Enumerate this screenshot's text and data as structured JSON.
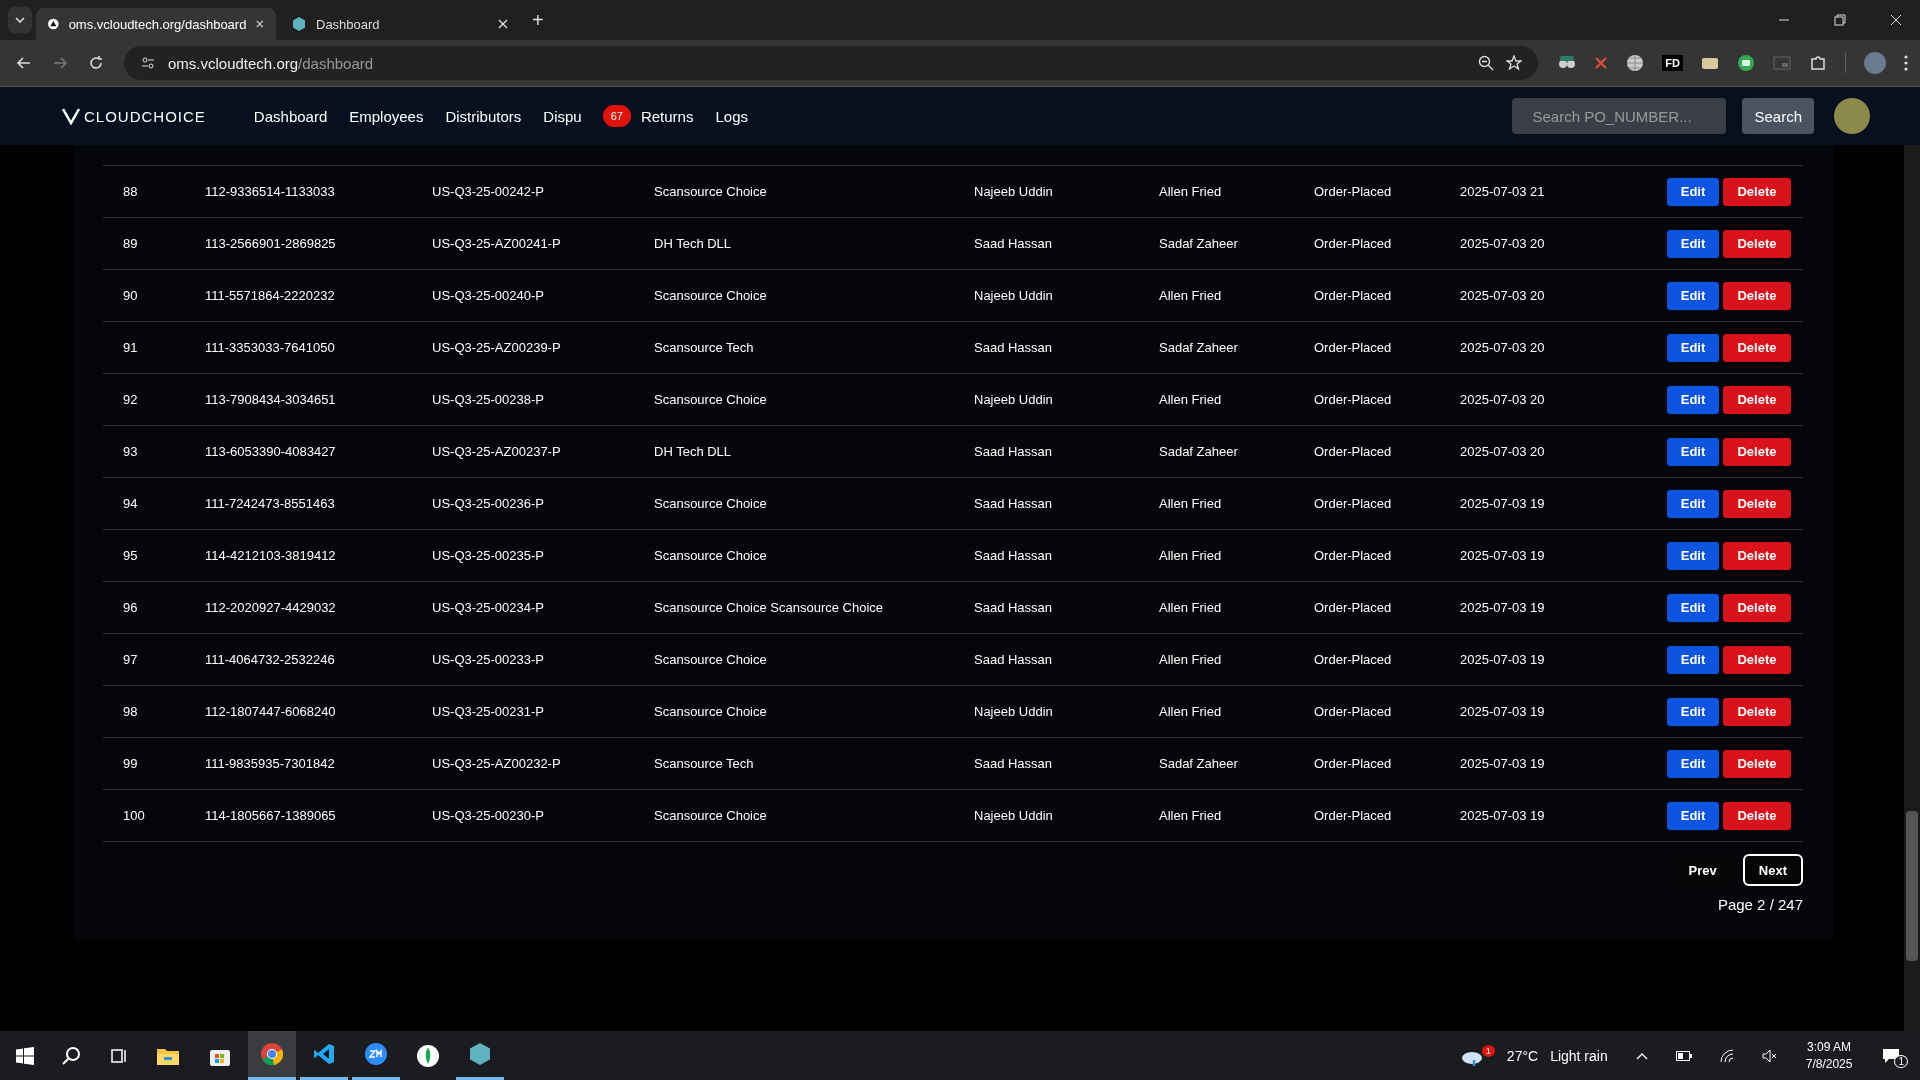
{
  "browser": {
    "tabs": [
      {
        "title": "oms.vcloudtech.org/dashboard",
        "selected": true
      },
      {
        "title": "Dashboard",
        "selected": false
      }
    ],
    "new_tab": "+",
    "extension_label": "FD",
    "address": {
      "host": "oms.vcloudtech.org",
      "path": "/dashboard"
    }
  },
  "nav": {
    "logo": "CLOUDCHOICE",
    "links": [
      {
        "label": "Dashboard"
      },
      {
        "label": "Employees"
      },
      {
        "label": "Distributors"
      },
      {
        "label": "Dispu",
        "badge": "67"
      },
      {
        "label": "Returns"
      },
      {
        "label": "Logs"
      }
    ],
    "search": {
      "placeholder": "Search PO_NUMBER..."
    },
    "search_button": "Search"
  },
  "table": {
    "rows": [
      {
        "cells": [
          "88",
          "112-9336514-1133033",
          "US-Q3-25-00242-P",
          "Scansource Choice",
          "Najeeb Uddin",
          "Allen Fried",
          "Order-Placed",
          "2025-07-03 21"
        ],
        "actions": [
          "Edit",
          "Delete"
        ]
      },
      {
        "cells": [
          "89",
          "113-2566901-2869825",
          "US-Q3-25-AZ00241-P",
          "DH Tech DLL",
          "Saad Hassan",
          "Sadaf Zaheer",
          "Order-Placed",
          "2025-07-03 20"
        ],
        "actions": [
          "Edit",
          "Delete"
        ]
      },
      {
        "cells": [
          "90",
          "111-5571864-2220232",
          "US-Q3-25-00240-P",
          "Scansource Choice",
          "Najeeb Uddin",
          "Allen Fried",
          "Order-Placed",
          "2025-07-03 20"
        ],
        "actions": [
          "Edit",
          "Delete"
        ]
      },
      {
        "cells": [
          "91",
          "111-3353033-7641050",
          "US-Q3-25-AZ00239-P",
          "Scansource Tech",
          "Saad Hassan",
          "Sadaf Zaheer",
          "Order-Placed",
          "2025-07-03 20"
        ],
        "actions": [
          "Edit",
          "Delete"
        ]
      },
      {
        "cells": [
          "92",
          "113-7908434-3034651",
          "US-Q3-25-00238-P",
          "Scansource Choice",
          "Najeeb Uddin",
          "Allen Fried",
          "Order-Placed",
          "2025-07-03 20"
        ],
        "actions": [
          "Edit",
          "Delete"
        ]
      },
      {
        "cells": [
          "93",
          "113-6053390-4083427",
          "US-Q3-25-AZ00237-P",
          "DH Tech DLL",
          "Saad Hassan",
          "Sadaf Zaheer",
          "Order-Placed",
          "2025-07-03 20"
        ],
        "actions": [
          "Edit",
          "Delete"
        ]
      },
      {
        "cells": [
          "94",
          "111-7242473-8551463",
          "US-Q3-25-00236-P",
          "Scansource Choice",
          "Saad Hassan",
          "Allen Fried",
          "Order-Placed",
          "2025-07-03 19"
        ],
        "actions": [
          "Edit",
          "Delete"
        ]
      },
      {
        "cells": [
          "95",
          "114-4212103-3819412",
          "US-Q3-25-00235-P",
          "Scansource Choice",
          "Saad Hassan",
          "Allen Fried",
          "Order-Placed",
          "2025-07-03 19"
        ],
        "actions": [
          "Edit",
          "Delete"
        ]
      },
      {
        "cells": [
          "96",
          "112-2020927-4429032",
          "US-Q3-25-00234-P",
          "Scansource Choice Scansource Choice",
          "Saad Hassan",
          "Allen Fried",
          "Order-Placed",
          "2025-07-03 19"
        ],
        "actions": [
          "Edit",
          "Delete"
        ]
      },
      {
        "cells": [
          "97",
          "111-4064732-2532246",
          "US-Q3-25-00233-P",
          "Scansource Choice",
          "Saad Hassan",
          "Allen Fried",
          "Order-Placed",
          "2025-07-03 19"
        ],
        "actions": [
          "Edit",
          "Delete"
        ]
      },
      {
        "cells": [
          "98",
          "112-1807447-6068240",
          "US-Q3-25-00231-P",
          "Scansource Choice",
          "Najeeb Uddin",
          "Allen Fried",
          "Order-Placed",
          "2025-07-03 19"
        ],
        "actions": [
          "Edit",
          "Delete"
        ]
      },
      {
        "cells": [
          "99",
          "111-9835935-7301842",
          "US-Q3-25-AZ00232-P",
          "Scansource Tech",
          "Saad Hassan",
          "Sadaf Zaheer",
          "Order-Placed",
          "2025-07-03 19"
        ],
        "actions": [
          "Edit",
          "Delete"
        ]
      },
      {
        "cells": [
          "100",
          "114-1805667-1389065",
          "US-Q3-25-00230-P",
          "Scansource Choice",
          "Najeeb Uddin",
          "Allen Fried",
          "Order-Placed",
          "2025-07-03 19"
        ],
        "actions": [
          "Edit",
          "Delete"
        ]
      }
    ]
  },
  "pagination": {
    "prev": "Prev",
    "next": "Next",
    "page": "Page 2 / 247"
  },
  "taskbar": {
    "weather": {
      "badge": "1",
      "temp": "27°C",
      "text": "Light rain"
    },
    "time": "3:09 AM",
    "date": "7/8/2025",
    "notifications": "1"
  }
}
